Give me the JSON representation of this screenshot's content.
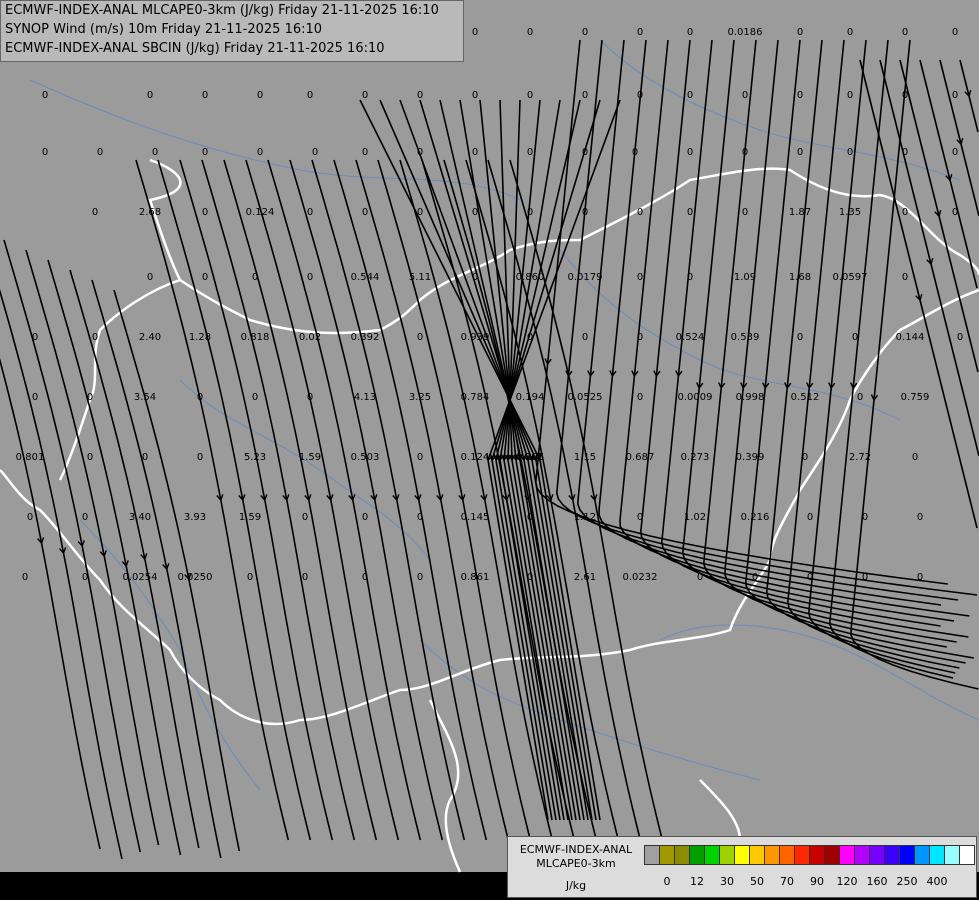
{
  "header": {
    "line1": "ECMWF-INDEX-ANAL MLCAPE0-3km (J/kg) Friday 21-11-2025 16:10",
    "line2": "SYNOP Wind (m/s) 10m Friday 21-11-2025 16:10",
    "line3": "ECMWF-INDEX-ANAL SBCIN (J/kg) Friday 21-11-2025 16:10"
  },
  "legend": {
    "title1": "ECMWF-INDEX-ANAL",
    "title2": "MLCAPE0-3km",
    "unit": "J/kg",
    "colors": [
      "#a0a0a0",
      "#a09a00",
      "#8c8c00",
      "#00a000",
      "#00d200",
      "#9bd200",
      "#ffff00",
      "#ffc800",
      "#ff9600",
      "#ff6400",
      "#ff2800",
      "#c80000",
      "#a00000",
      "#ff00ff",
      "#b400ff",
      "#7800ff",
      "#3c00ff",
      "#0000ff",
      "#0096ff",
      "#00e6ff",
      "#96ffff",
      "#ffffff"
    ],
    "ticks": [
      "0",
      "12",
      "30",
      "50",
      "70",
      "90",
      "120",
      "160",
      "250",
      "400"
    ]
  },
  "map_colors": {
    "background": "#9b9b9b",
    "border": "#ffffff",
    "river": "#6b8bbd",
    "streamline": "#000000"
  },
  "values": [
    "0",
    "0",
    "0",
    "0",
    "0",
    "0.0186",
    "0",
    "0",
    "0",
    "0",
    "0",
    "0",
    "0",
    "0",
    "0",
    "0",
    "0",
    "0",
    "0",
    "0",
    "0",
    "0",
    "0",
    "0",
    "0",
    "0",
    "0",
    "0",
    "0",
    "0",
    "0",
    "0",
    "0",
    "0",
    "0",
    "0",
    "0",
    "0",
    "0",
    "0",
    "0",
    "0",
    "0",
    "0",
    "0",
    "0",
    "2.68",
    "0",
    "0.124",
    "0",
    "0",
    "0",
    "0",
    "0",
    "0",
    "0",
    "0",
    "0",
    "1.87",
    "1.35",
    "0",
    "0",
    "0",
    "0",
    "0",
    "0",
    "0.544",
    "5.11",
    "0",
    "0.860",
    "0.0179",
    "0",
    "0",
    "1.09",
    "1.68",
    "0.0597",
    "0",
    "0",
    "0",
    "2.40",
    "1.28",
    "0.818",
    "0.02",
    "0.392",
    "0",
    "0.939",
    "0",
    "0",
    "0",
    "0.524",
    "0.539",
    "0",
    "0",
    "0.144",
    "0",
    "0",
    "0",
    "3.54",
    "0",
    "0",
    "0",
    "4.13",
    "3.25",
    "0.784",
    "0.194",
    "0.0525",
    "0",
    "0.0009",
    "0.998",
    "0.512",
    "0",
    "0.759",
    "0.801",
    "0",
    "0",
    "0",
    "5.23",
    "1.59",
    "0.503",
    "0",
    "0.124",
    "0.295",
    "1.15",
    "0.687",
    "0.273",
    "0.399",
    "0",
    "2.72",
    "0",
    "0",
    "0",
    "3.40",
    "3.93",
    "1.59",
    "0",
    "0",
    "0",
    "0.145",
    "0",
    "1.12",
    "0",
    "1.02",
    "0.216",
    "0",
    "0",
    "0",
    "0",
    "0",
    "0.0254",
    "0.0250",
    "0",
    "0",
    "0",
    "0",
    "0.861",
    "0",
    "2.61",
    "0.0232",
    "0",
    "0",
    "0",
    "0",
    "0"
  ]
}
